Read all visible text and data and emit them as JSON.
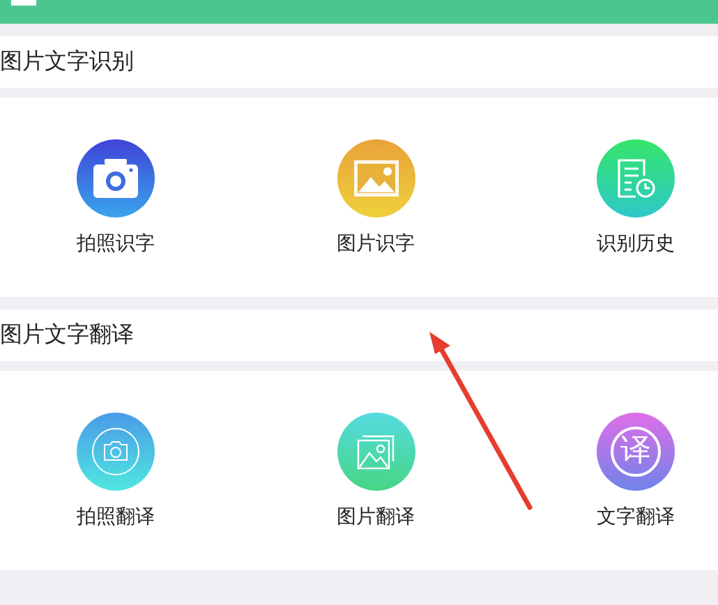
{
  "sections": [
    {
      "title": "图片文字识别",
      "items": [
        {
          "label": "拍照识字",
          "kind": "camera"
        },
        {
          "label": "图片识字",
          "kind": "picture"
        },
        {
          "label": "识别历史",
          "kind": "history"
        }
      ]
    },
    {
      "title": "图片文字翻译",
      "items": [
        {
          "label": "拍照翻译",
          "kind": "camera-outline"
        },
        {
          "label": "图片翻译",
          "kind": "pictures"
        },
        {
          "label": "文字翻译",
          "kind": "glyph",
          "glyph": "译"
        }
      ]
    }
  ]
}
